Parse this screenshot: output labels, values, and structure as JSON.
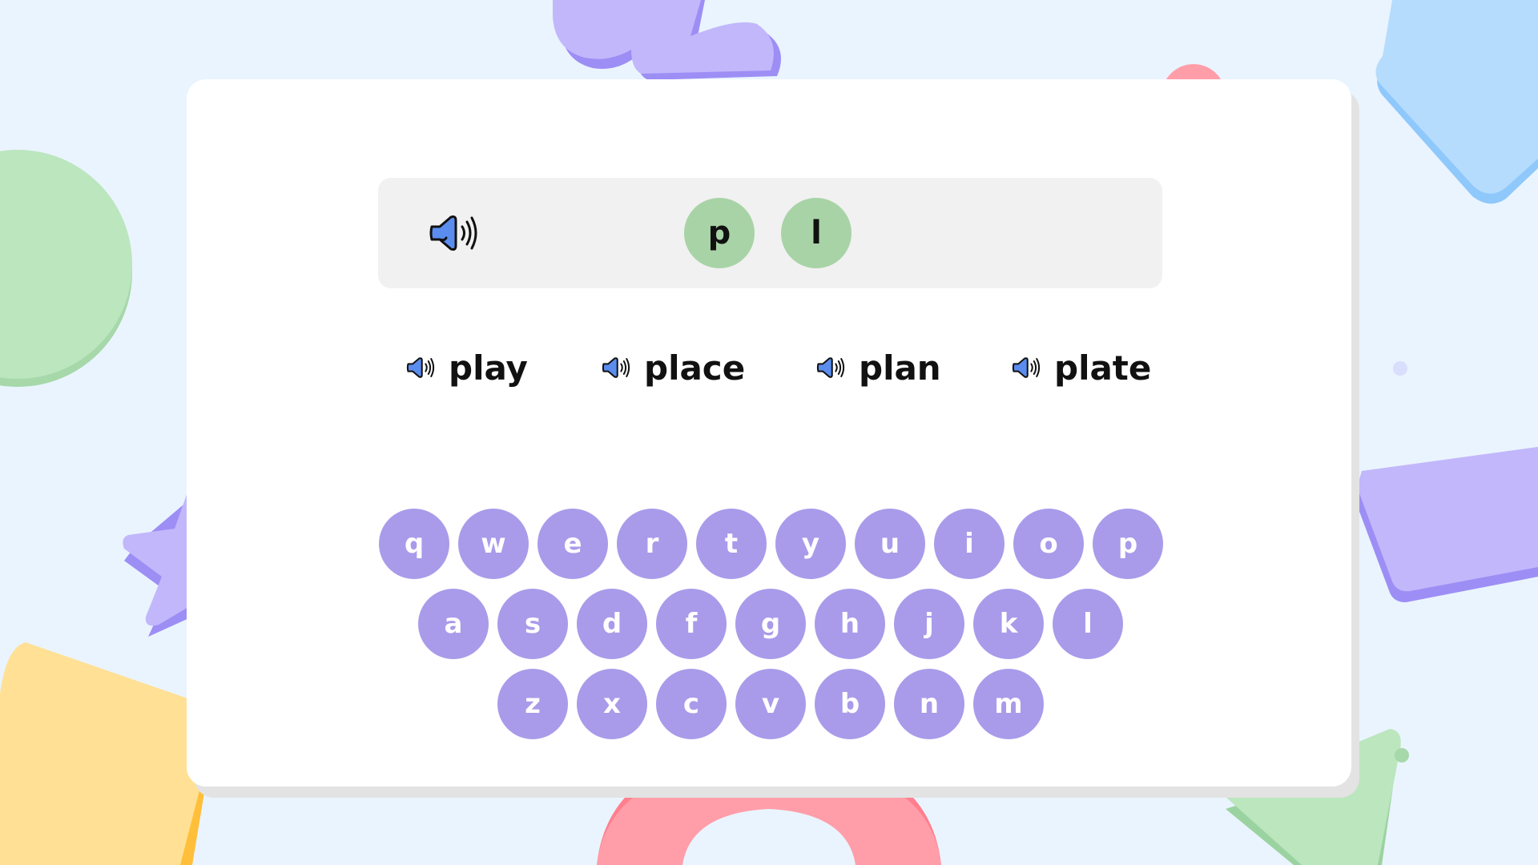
{
  "colors": {
    "background": "#eaf4fe",
    "card": "#ffffff",
    "panel": "#f1f1f1",
    "slot": "#a8d3a6",
    "key": "#a99bea",
    "speaker": "#5b8def"
  },
  "answer": {
    "speaker_icon": "speaker-icon",
    "letters": [
      "p",
      "l"
    ]
  },
  "words": [
    {
      "label": "play",
      "icon": "speaker-icon"
    },
    {
      "label": "place",
      "icon": "speaker-icon"
    },
    {
      "label": "plan",
      "icon": "speaker-icon"
    },
    {
      "label": "plate",
      "icon": "speaker-icon"
    }
  ],
  "keyboard": {
    "row1": [
      "q",
      "w",
      "e",
      "r",
      "t",
      "y",
      "u",
      "i",
      "o",
      "p"
    ],
    "row2": [
      "a",
      "s",
      "d",
      "f",
      "g",
      "h",
      "j",
      "k",
      "l"
    ],
    "row3": [
      "z",
      "x",
      "c",
      "v",
      "b",
      "n",
      "m"
    ]
  }
}
